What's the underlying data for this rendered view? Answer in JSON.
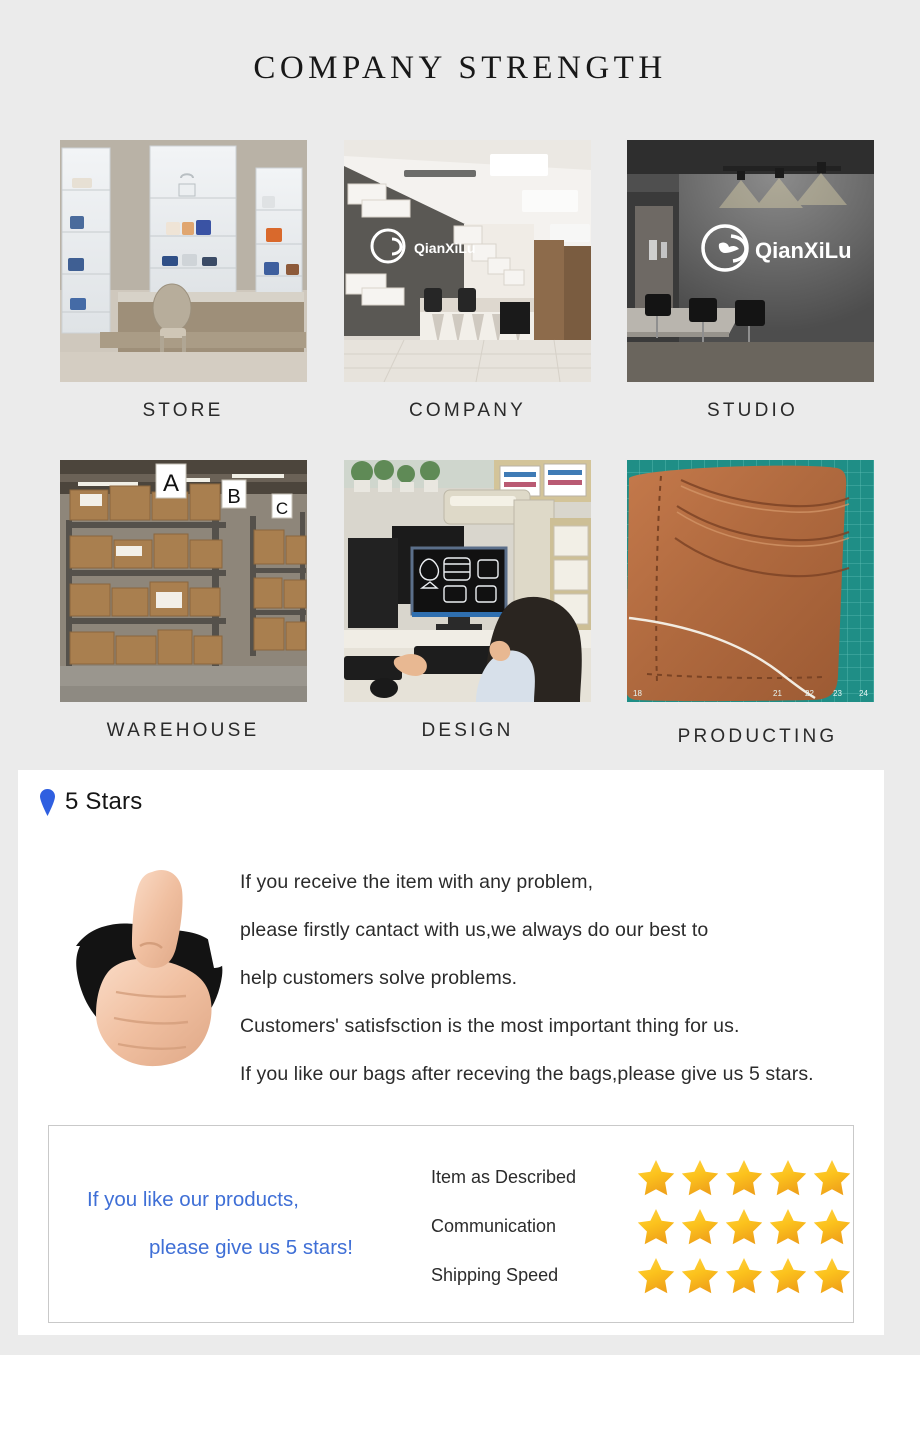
{
  "page": {
    "title": "COMPANY STRENGTH",
    "background_color": "#ebebeb",
    "card_background": "#ffffff"
  },
  "gallery": {
    "row1": [
      {
        "caption": "STORE",
        "icon": "store-photo",
        "alt": "Retail store with glass display shelves of handbags"
      },
      {
        "caption": "COMPANY",
        "icon": "company-photo",
        "alt": "Office reception lobby with QianXiLu wall logo"
      },
      {
        "caption": "STUDIO",
        "icon": "studio-photo",
        "alt": "Dark meeting room with illuminated QianXiLu logo"
      }
    ],
    "row2": [
      {
        "caption": "WAREHOUSE",
        "icon": "warehouse-photo",
        "alt": "Warehouse racking with cartons labelled A B C"
      },
      {
        "caption": "DESIGN",
        "icon": "design-photo",
        "alt": "Designer at computer workstation with CAD pattern"
      },
      {
        "caption": "PRODUCTING",
        "icon": "producing-photo",
        "alt": "Brown leather panel on green cutting mat"
      }
    ],
    "brand_logo_text": "QianXiLu"
  },
  "review": {
    "heading": "5 Stars",
    "pin_color": "#2f5fe0",
    "thumb_icon": "thumbs-up-through-paper",
    "lines": [
      "If you receive the item with any problem,",
      "please firstly cantact with us,we always do our best to",
      "help customers solve problems.",
      "Customers' satisfsction is the most important thing for us.",
      "If you like our bags after receving the bags,please give us 5 stars."
    ]
  },
  "rating_box": {
    "promo_color": "#3f6fd6",
    "promo_lines": [
      "If you like our products,",
      "please give us 5 stars!"
    ],
    "star_color": "#fdc219",
    "rows": [
      {
        "label": "Item as Described",
        "stars": 5
      },
      {
        "label": "Communication",
        "stars": 5
      },
      {
        "label": "Shipping Speed",
        "stars": 5
      }
    ]
  }
}
